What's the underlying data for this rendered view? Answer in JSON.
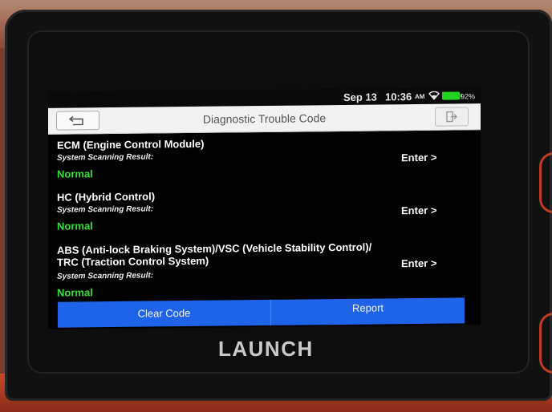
{
  "status": {
    "date": "Sep 13",
    "time": "10:36",
    "ampm": "AM",
    "battery_pct": "92%",
    "battery_color": "#22d41f"
  },
  "header": {
    "title": "Diagnostic Trouble Code",
    "back_icon": "back-arrow-icon",
    "exit_icon": "exit-icon"
  },
  "modules": [
    {
      "name": "ECM (Engine Control Module)",
      "label": "System Scanning Result:",
      "result": "Normal",
      "action": "Enter >"
    },
    {
      "name": "HC (Hybrid Control)",
      "label": "System Scanning Result:",
      "result": "Normal",
      "action": "Enter >"
    },
    {
      "name": "ABS (Anti-lock Braking System)/VSC (Vehicle Stability Control)/ TRC (Traction Control System)",
      "label": "System Scanning Result:",
      "result": "Normal",
      "action": "Enter >"
    }
  ],
  "footer": {
    "clear_label": "Clear Code",
    "report_label": "Report",
    "accent_color": "#1e63e8"
  },
  "device": {
    "brand": "LAUNCH"
  }
}
